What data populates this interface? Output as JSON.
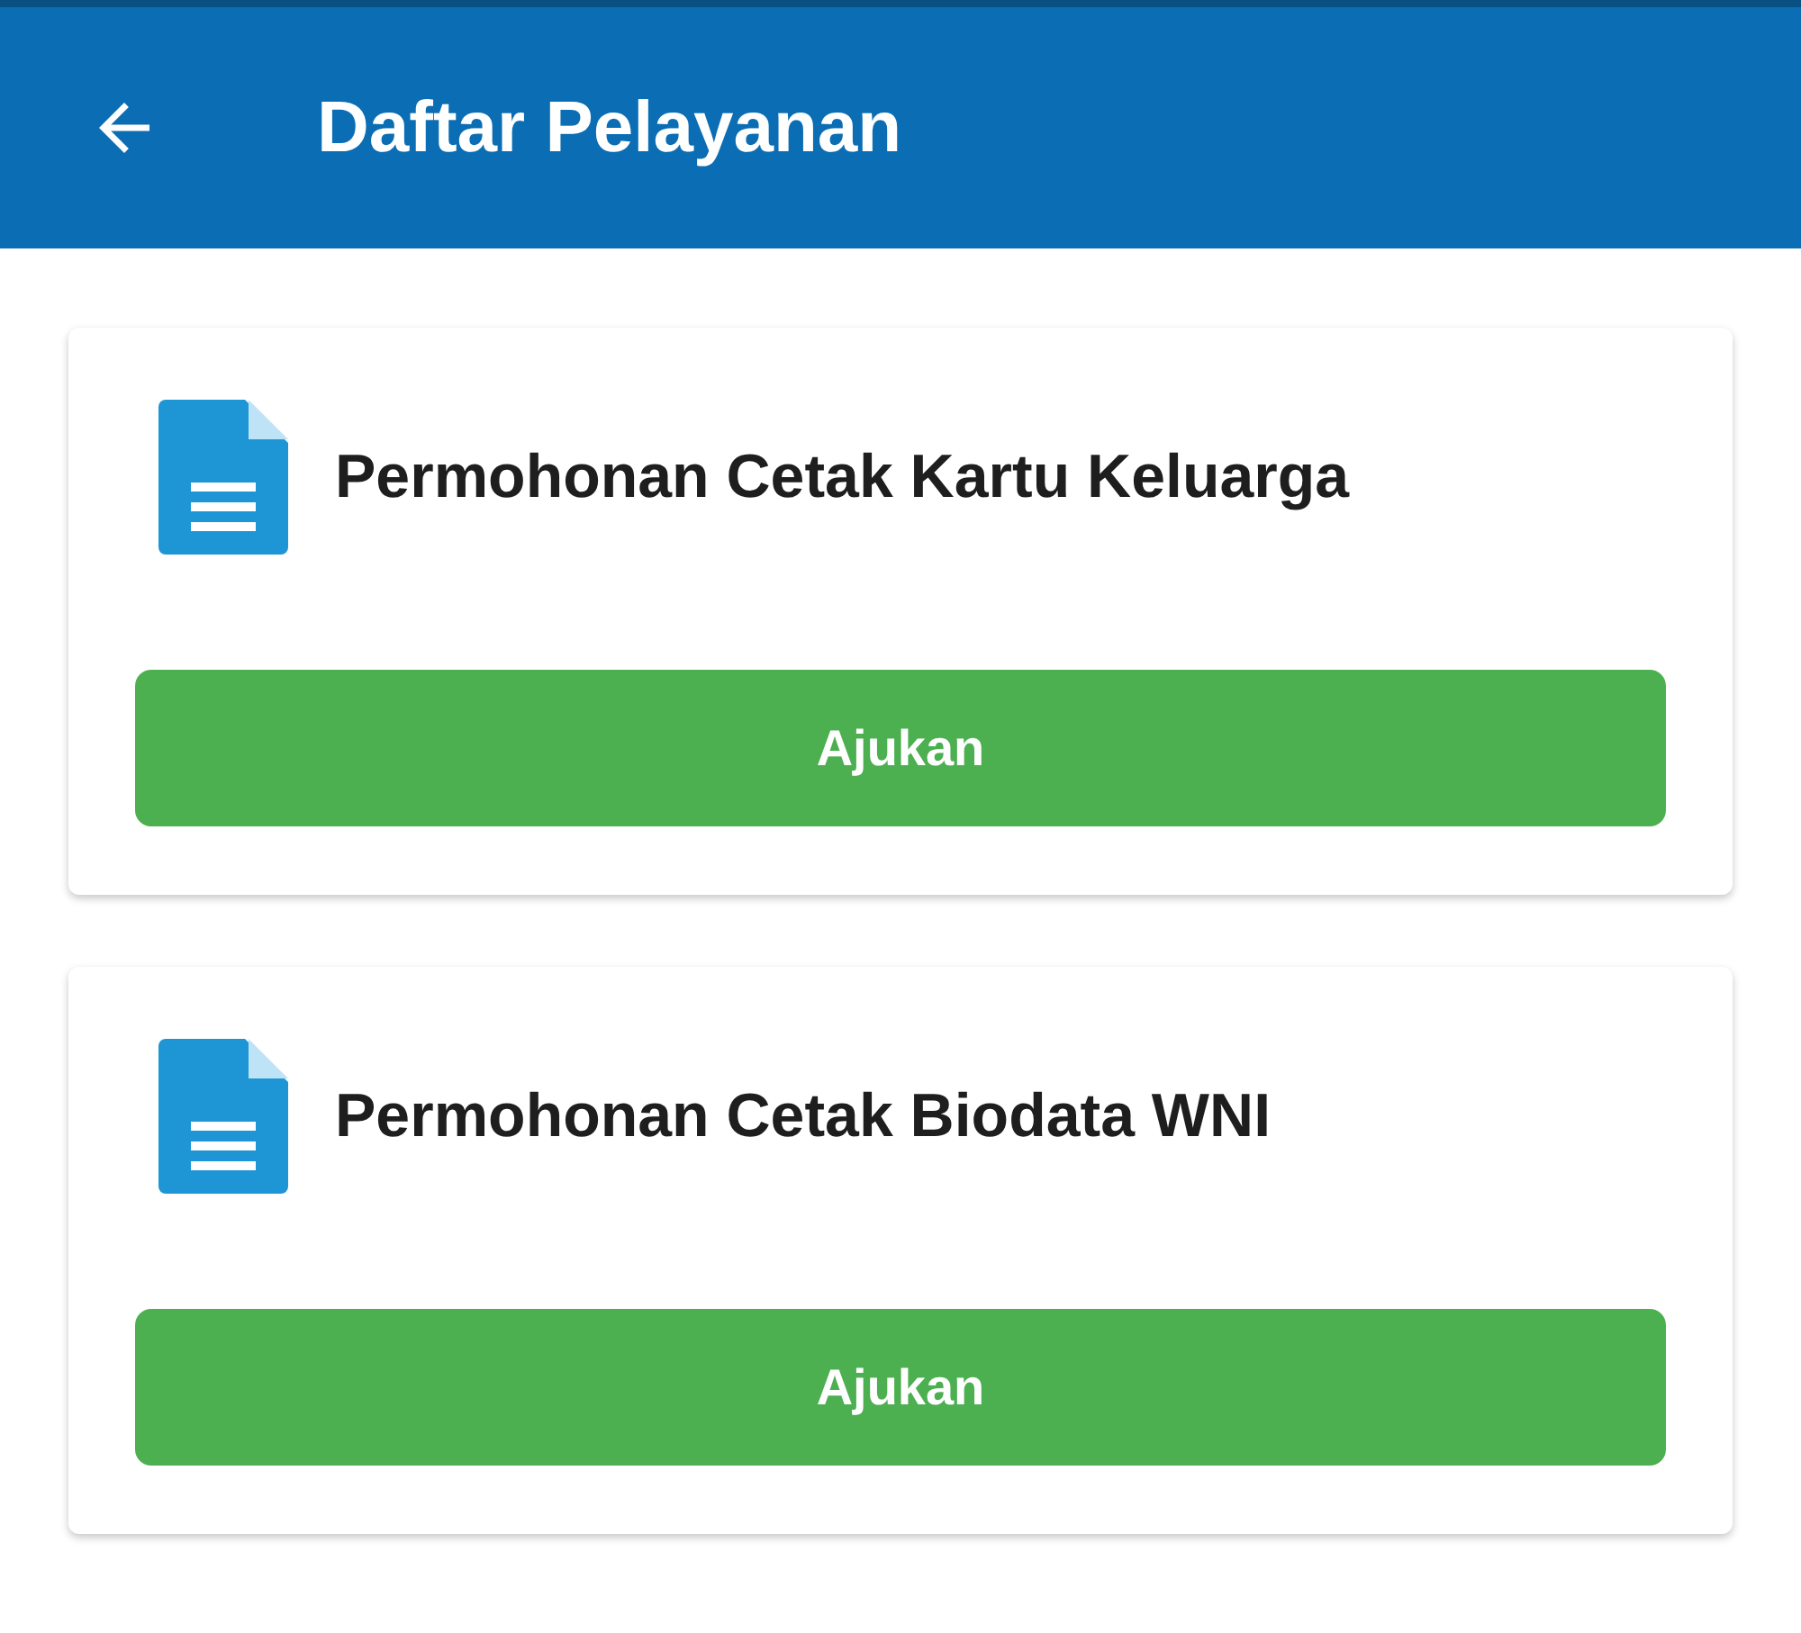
{
  "app_bar": {
    "title": "Daftar Pelayanan"
  },
  "services": [
    {
      "title": "Permohonan Cetak Kartu Keluarga",
      "button": "Ajukan"
    },
    {
      "title": "Permohonan Cetak Biodata WNI",
      "button": "Ajukan"
    }
  ]
}
